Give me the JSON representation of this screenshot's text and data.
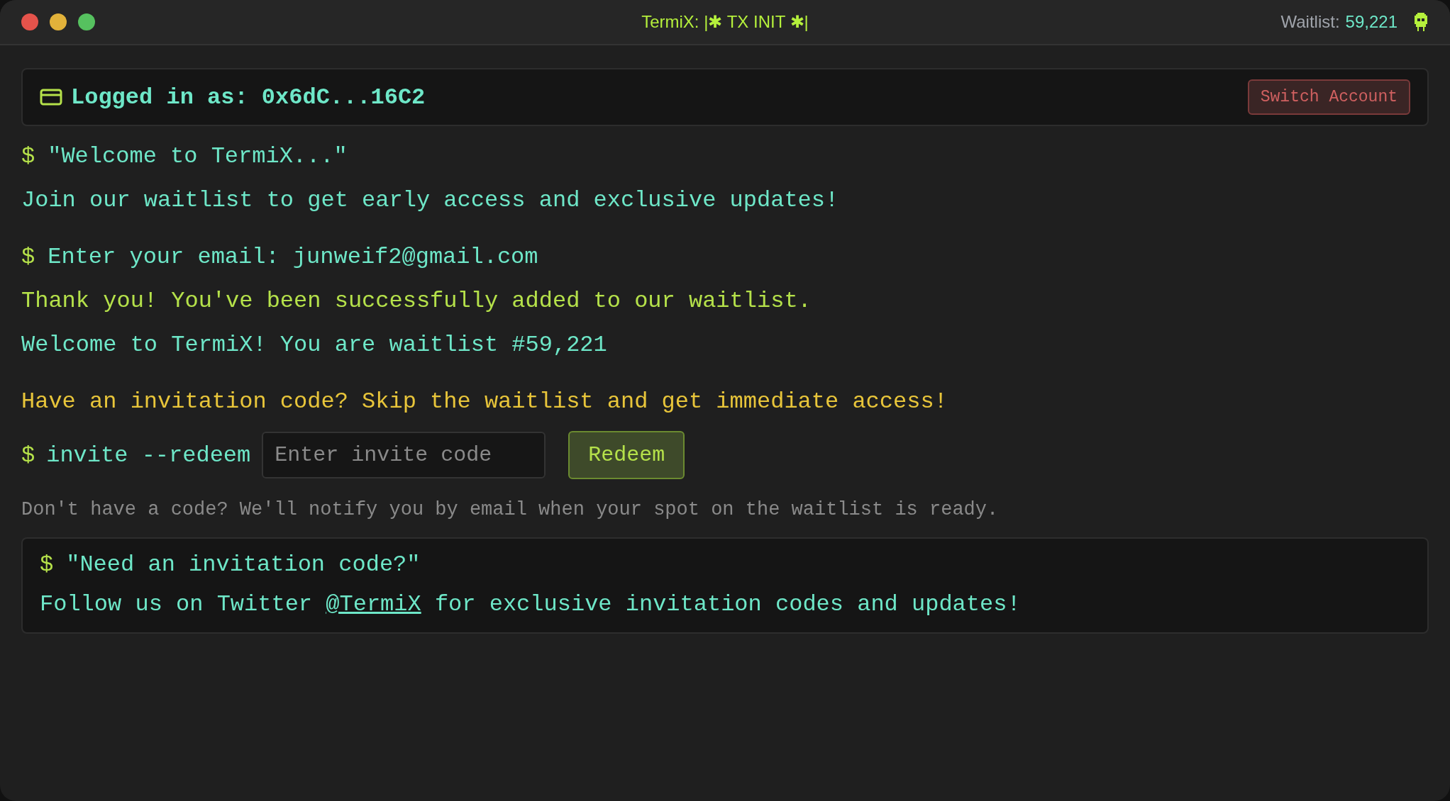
{
  "window": {
    "title": "TermiX: |✱ TX INIT ✱|",
    "waitlist_label": "Waitlist:",
    "waitlist_count": "59,221"
  },
  "account": {
    "label": "Logged in as: 0x6dC...16C2",
    "button": "Switch Account"
  },
  "log": [
    {
      "kind": "command",
      "prompt": "$",
      "text": "\"Welcome to TermiX...\"",
      "color": "#6ee7c8"
    },
    {
      "kind": "message",
      "text": "Join our waitlist to get early access and exclusive updates!",
      "color": "#6ee7c8"
    },
    {
      "kind": "command",
      "prompt": "$",
      "text": "Enter your email: junweif2@gmail.com",
      "color": "#6ee7c8"
    },
    {
      "kind": "message",
      "text": "Thank you! You've been successfully added to our waitlist.",
      "color": "#b5e14a"
    },
    {
      "kind": "message",
      "text": "Welcome to TermiX! You are waitlist #59,221",
      "color": "#6ee7c8"
    },
    {
      "kind": "message",
      "text": "Have an invitation code? Skip the waitlist and get immediate access!",
      "color": "#e8c53a"
    }
  ],
  "invite": {
    "prompt": "$",
    "command": "invite --redeem",
    "placeholder": "Enter invite code",
    "button": "Redeem"
  },
  "note": "Don't have a code? We'll notify you by email when your spot on the waitlist is ready.",
  "promo": {
    "prompt": "$",
    "heading": "\"Need an invitation code?\"",
    "text_before": "Follow us on Twitter",
    "link": "@TermiX",
    "text_after": "for exclusive invitation codes and updates!"
  }
}
